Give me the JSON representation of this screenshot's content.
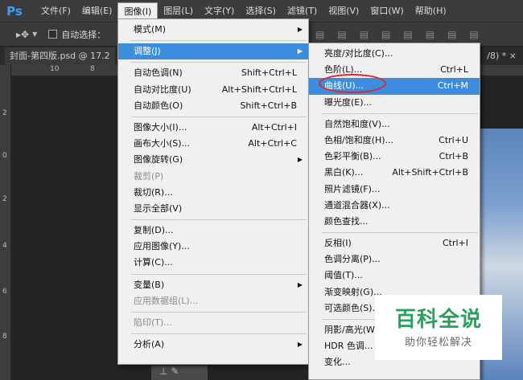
{
  "app": {
    "logo": "Ps"
  },
  "menubar": {
    "items": [
      "文件(F)",
      "编辑(E)",
      "图像(I)",
      "图层(L)",
      "文字(Y)",
      "选择(S)",
      "滤镜(T)",
      "视图(V)",
      "窗口(W)",
      "帮助(H)"
    ],
    "active": "图像(I)"
  },
  "options": {
    "move_tool_icon": "move-tool-icon",
    "auto_select_label": "自动选择：",
    "auto_select_checked": false
  },
  "document": {
    "tab_title": "封面-第四版.psd @ 17.2",
    "tab_suffix": "/8) *",
    "close_glyph": "×"
  },
  "rulers": {
    "h_marks": [
      "10",
      "8"
    ],
    "v_marks": [
      "2",
      "0",
      "2",
      "4",
      "6",
      "8"
    ]
  },
  "image_menu": {
    "items": [
      {
        "label": "模式(M)",
        "submenu": true
      },
      {
        "separator": true
      },
      {
        "label": "调整(J)",
        "submenu": true,
        "highlight": true
      },
      {
        "separator": true
      },
      {
        "label": "自动色调(N)",
        "shortcut": "Shift+Ctrl+L"
      },
      {
        "label": "自动对比度(U)",
        "shortcut": "Alt+Shift+Ctrl+L"
      },
      {
        "label": "自动颜色(O)",
        "shortcut": "Shift+Ctrl+B"
      },
      {
        "separator": true
      },
      {
        "label": "图像大小(I)...",
        "shortcut": "Alt+Ctrl+I"
      },
      {
        "label": "画布大小(S)...",
        "shortcut": "Alt+Ctrl+C"
      },
      {
        "label": "图像旋转(G)",
        "submenu": true
      },
      {
        "label": "裁剪(P)",
        "disabled": true
      },
      {
        "label": "裁切(R)..."
      },
      {
        "label": "显示全部(V)"
      },
      {
        "separator": true
      },
      {
        "label": "复制(D)..."
      },
      {
        "label": "应用图像(Y)..."
      },
      {
        "label": "计算(C)..."
      },
      {
        "separator": true
      },
      {
        "label": "变量(B)",
        "submenu": true
      },
      {
        "label": "应用数据组(L)...",
        "disabled": true
      },
      {
        "separator": true
      },
      {
        "label": "陷印(T)...",
        "disabled": true
      },
      {
        "separator": true
      },
      {
        "label": "分析(A)",
        "submenu": true
      }
    ]
  },
  "adjust_submenu": {
    "items": [
      {
        "label": "亮度/对比度(C)..."
      },
      {
        "label": "色阶(L)...",
        "shortcut": "Ctrl+L"
      },
      {
        "label": "曲线(U)...",
        "shortcut": "Ctrl+M",
        "highlight": true
      },
      {
        "label": "曝光度(E)..."
      },
      {
        "separator": true
      },
      {
        "label": "自然饱和度(V)..."
      },
      {
        "label": "色相/饱和度(H)...",
        "shortcut": "Ctrl+U"
      },
      {
        "label": "色彩平衡(B)...",
        "shortcut": "Ctrl+B"
      },
      {
        "label": "黑白(K)...",
        "shortcut": "Alt+Shift+Ctrl+B"
      },
      {
        "label": "照片滤镜(F)..."
      },
      {
        "label": "通道混合器(X)..."
      },
      {
        "label": "颜色查找..."
      },
      {
        "separator": true
      },
      {
        "label": "反相(I)",
        "shortcut": "Ctrl+I"
      },
      {
        "label": "色调分离(P)..."
      },
      {
        "label": "阈值(T)..."
      },
      {
        "label": "渐变映射(G)..."
      },
      {
        "label": "可选颜色(S)..."
      },
      {
        "separator": true
      },
      {
        "label": "阴影/高光(W)..."
      },
      {
        "label": "HDR 色调..."
      },
      {
        "label": "变化..."
      }
    ]
  },
  "watermark": {
    "title": "百科全说",
    "subtitle": "助你轻松解决",
    "color": "#26a35b"
  },
  "colors": {
    "highlight": "#3c8dde",
    "annotation_circle": "#e0252b"
  }
}
